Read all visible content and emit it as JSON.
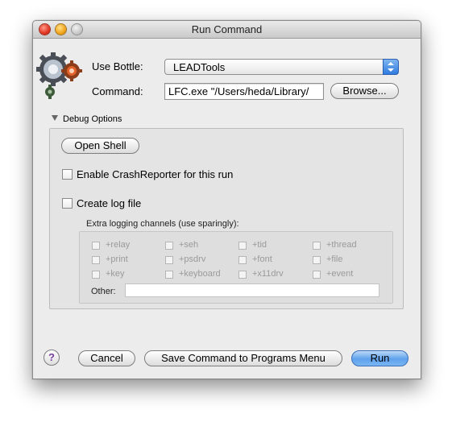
{
  "window": {
    "title": "Run Command"
  },
  "form": {
    "bottle_label": "Use Bottle:",
    "bottle_value": "LEADTools",
    "command_label": "Command:",
    "command_value": "LFC.exe \"/Users/heda/Library/",
    "browse_label": "Browse..."
  },
  "debug": {
    "toggle_label": "Debug Options",
    "open_shell": "Open Shell",
    "crash_reporter": "Enable CrashReporter for this run",
    "create_log": "Create log file",
    "extra_label": "Extra logging channels (use sparingly):",
    "channels": [
      "+relay",
      "+seh",
      "+tid",
      "+thread",
      "+print",
      "+psdrv",
      "+font",
      "+file",
      "+key",
      "+keyboard",
      "+x11drv",
      "+event"
    ],
    "other_label": "Other:",
    "other_value": ""
  },
  "buttons": {
    "help": "?",
    "cancel": "Cancel",
    "save": "Save Command to Programs Menu",
    "run": "Run"
  },
  "icons": [
    "gear-icon",
    "popup-stepper-icon",
    "disclosure-triangle-icon",
    "help-icon"
  ]
}
